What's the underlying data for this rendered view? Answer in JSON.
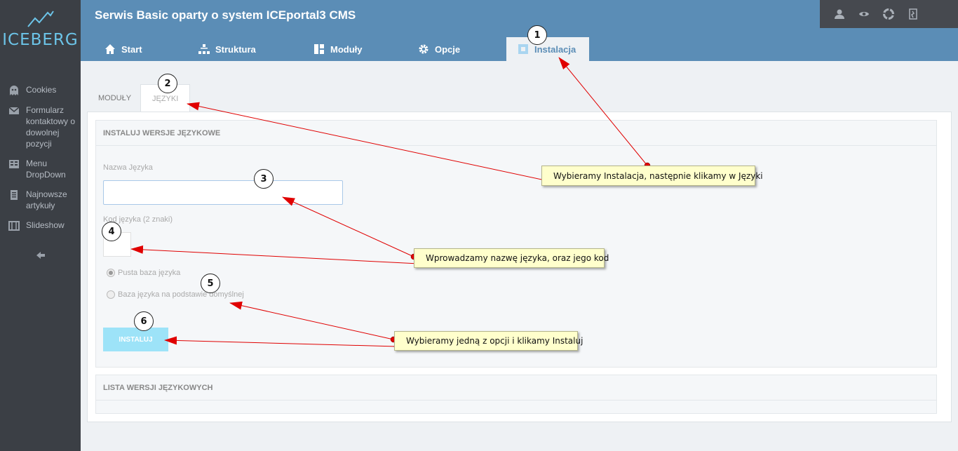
{
  "sidebar": {
    "logo_text": "ICEBERG",
    "items": [
      {
        "label": "Cookies",
        "icon": "ghost-icon"
      },
      {
        "label": "Formularz kontaktowy o dowolnej pozycji",
        "icon": "envelope-icon"
      },
      {
        "label": "Menu DropDown",
        "icon": "menu-icon"
      },
      {
        "label": "Najnowsze artykuły",
        "icon": "document-icon"
      },
      {
        "label": "Slideshow",
        "icon": "film-icon"
      }
    ]
  },
  "header": {
    "title": "Serwis Basic oparty o system ICEportal3 CMS",
    "tabs": [
      {
        "label": "Start",
        "icon": "home-icon"
      },
      {
        "label": "Struktura",
        "icon": "sitemap-icon"
      },
      {
        "label": "Moduły",
        "icon": "dashboard-icon"
      },
      {
        "label": "Opcje",
        "icon": "gear-icon"
      },
      {
        "label": "Instalacja",
        "icon": "install-icon",
        "active": true
      }
    ]
  },
  "subtabs": [
    {
      "label": "MODUŁY"
    },
    {
      "label": "JĘZYKI",
      "active": true
    }
  ],
  "install_section": {
    "title": "INSTALUJ WERSJE JĘZYKOWE",
    "name_label": "Nazwa Języka",
    "name_value": "",
    "code_label": "Kod języka (2 znaki)",
    "code_value": "",
    "radio_options": [
      {
        "label": "Pusta baza języka",
        "checked": true
      },
      {
        "label": "Baza języka na podstawie domyślnej",
        "checked": false
      }
    ],
    "install_button": "INSTALUJ"
  },
  "list_section": {
    "title": "LISTA WERSJI JĘZYKOWYCH"
  },
  "annotations": {
    "callouts": [
      "Wybieramy Instalacja, następnie klikamy w Języki",
      "Wprowadzamy nazwę języka, oraz jego kod",
      "Wybieramy jedną z opcji i klikamy Instaluj"
    ],
    "numbers": [
      "1",
      "2",
      "3",
      "4",
      "5",
      "6"
    ]
  },
  "colors": {
    "header_bg": "#5b8db6",
    "sidebar_bg": "#3b3f45",
    "logo": "#6cc4e8",
    "install_button": "#9de3f8",
    "callout_bg": "#ffffcc",
    "arrow": "#e00000"
  }
}
